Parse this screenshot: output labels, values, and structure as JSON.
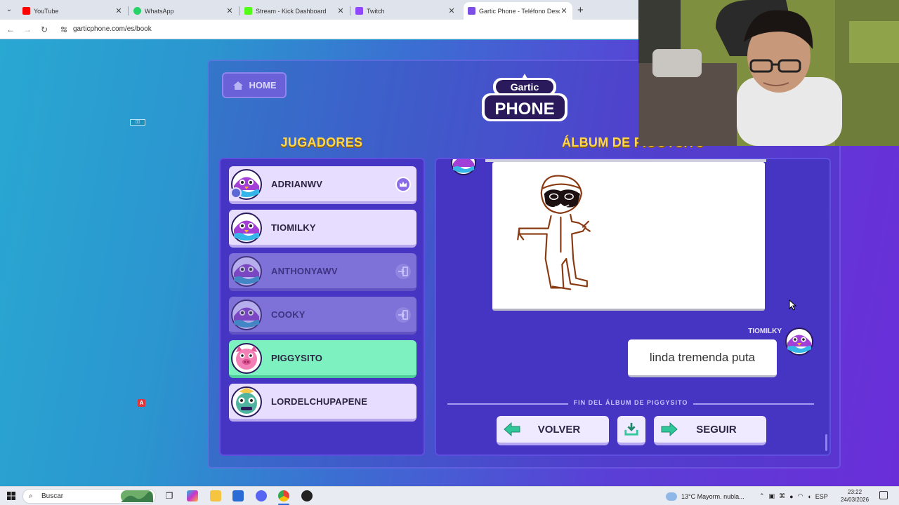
{
  "browser": {
    "tabs": [
      {
        "title": "YouTube",
        "color": "#ff0000"
      },
      {
        "title": "WhatsApp",
        "color": "#25d366"
      },
      {
        "title": "Stream - Kick Dashboard",
        "color": "#53fc18"
      },
      {
        "title": "Twitch",
        "color": "#9146ff"
      },
      {
        "title": "Gartic Phone - Teléfono Descor",
        "color": "#7b4ee6"
      }
    ],
    "url": "garticphone.com/es/book"
  },
  "page": {
    "home_label": "HOME",
    "logo_top": "Gartic",
    "logo_bottom": "PHONE",
    "players_title": "JUGADORES",
    "album_title": "ÁLBUM DE PIGGYSITO",
    "players": [
      {
        "name": "ADRIANWV",
        "status": "host",
        "badge": "crown-icon"
      },
      {
        "name": "TIOMILKY",
        "status": "active",
        "badge": ""
      },
      {
        "name": "ANTHONYAWV",
        "status": "left",
        "badge": "exit-icon"
      },
      {
        "name": "COOKY",
        "status": "left",
        "badge": "exit-icon"
      },
      {
        "name": "PIGGYSITO",
        "status": "current",
        "badge": ""
      },
      {
        "name": "LORDELCHUPAPENE",
        "status": "active",
        "badge": ""
      }
    ],
    "album": {
      "author": "TIOMILKY",
      "guess": "linda tremenda puta",
      "end_label": "FIN DEL ÁLBUM DE PIGGYSITO",
      "back_label": "VOLVER",
      "next_label": "SEGUIR"
    }
  },
  "taskbar": {
    "search_placeholder": "Buscar",
    "weather": "13°C  Mayorm. nubla...",
    "language": "ESP",
    "time": "23:22",
    "date": "24/03/2026"
  }
}
